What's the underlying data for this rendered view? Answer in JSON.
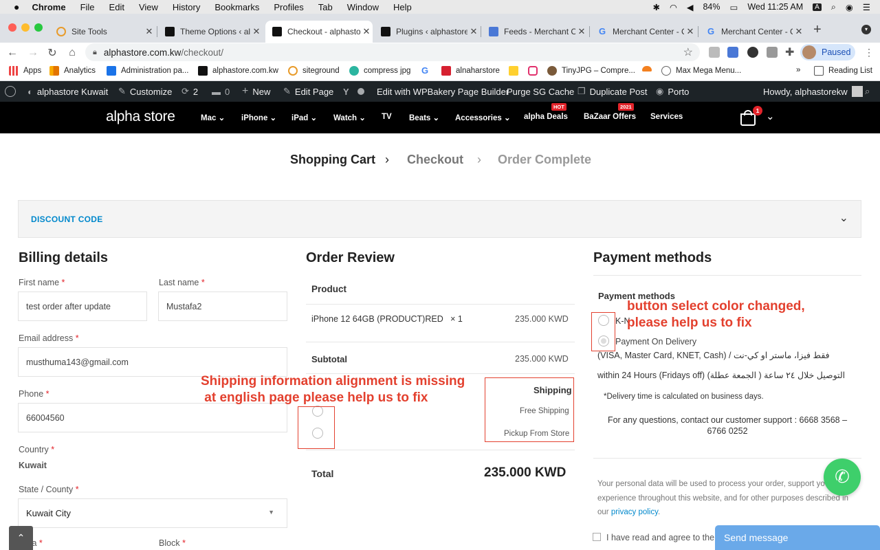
{
  "mac": {
    "apple": "",
    "menu": [
      "Chrome",
      "File",
      "Edit",
      "View",
      "History",
      "Bookmarks",
      "Profiles",
      "Tab",
      "Window",
      "Help"
    ],
    "battery": "84%",
    "clock": "Wed 11:25 AM"
  },
  "tabs": [
    {
      "title": "Site Tools"
    },
    {
      "title": "Theme Options ‹ alp"
    },
    {
      "title": "Checkout - alphasto"
    },
    {
      "title": "Plugins ‹ alphastore"
    },
    {
      "title": "Feeds - Merchant C"
    },
    {
      "title": "Merchant Center - C"
    },
    {
      "title": "Merchant Center - C"
    }
  ],
  "address": {
    "domain": "alphastore.com.kw",
    "path": "/checkout/"
  },
  "profile": {
    "status": "Paused"
  },
  "bookmarks": [
    "Apps",
    "Analytics",
    "Administration pa...",
    "alphastore.com.kw",
    "siteground",
    "compress jpg",
    "alnaharstore",
    "TinyJPG – Compre...",
    "Max Mega Menu..."
  ],
  "reading_list": "Reading List",
  "wp": {
    "site": "alphastore Kuwait",
    "customize": "Customize",
    "updates": "2",
    "comments": "0",
    "new": "New",
    "edit": "Edit Page",
    "wpbakery": "Edit with WPBakery Page Builder",
    "purge": "Purge SG Cache",
    "duplicate": "Duplicate Post",
    "porto": "Porto",
    "howdy": "Howdy, alphastorekw"
  },
  "site": {
    "logo": "alpha store",
    "nav": [
      {
        "label": "Mac",
        "dd": true
      },
      {
        "label": "iPhone",
        "dd": true
      },
      {
        "label": "iPad",
        "dd": true
      },
      {
        "label": "Watch",
        "dd": true
      },
      {
        "label": "TV",
        "dd": false
      },
      {
        "label": "Beats",
        "dd": true
      },
      {
        "label": "Accessories",
        "dd": true
      },
      {
        "label": "alpha Deals",
        "dd": false,
        "badge": "HOT"
      },
      {
        "label": "BaZaar Offers",
        "dd": false,
        "badge": "2021"
      },
      {
        "label": "Services",
        "dd": false
      }
    ],
    "cart_count": "1"
  },
  "steps": [
    "Shopping Cart",
    "Checkout",
    "Order Complete"
  ],
  "discount_label": "DISCOUNT CODE",
  "billing": {
    "title": "Billing details",
    "first_name_label": "First name",
    "first_name": "test order after update",
    "last_name_label": "Last name",
    "last_name": "Mustafa2",
    "email_label": "Email address",
    "email": "musthuma143@gmail.com",
    "phone_label": "Phone",
    "phone": "66004560",
    "country_label": "Country",
    "country": "Kuwait",
    "state_label": "State / County",
    "state": "Kuwait City",
    "area_label": "Area",
    "block_label": "Block",
    "required_mark": "*"
  },
  "order": {
    "title": "Order Review",
    "product_header": "Product",
    "item": "iPhone 12 64GB (PRODUCT)RED",
    "qty": "× 1",
    "item_price": "235.000 KWD",
    "subtotal_label": "Subtotal",
    "subtotal": "235.000 KWD",
    "shipping_label": "Shipping",
    "shipping_options": [
      "Free Shipping",
      "Pickup From Store"
    ],
    "total_label": "Total",
    "total": "235.000 KWD"
  },
  "payment": {
    "title": "Payment methods",
    "sub": "Payment methods",
    "opt1": "K-N",
    "opt2": "Payment On Delivery",
    "line1_en": "(VISA, Master Card, KNET, Cash) /",
    "line1_ar": "فقط فيزا، ماستر او كي-نت",
    "line2_en": "within 24 Hours (Fridays off)",
    "line2_ar": "التوصيل خلال ٢٤ ساعة ( الجمعة عطلة)",
    "delivery_note": "*Delivery time is calculated on business days.",
    "support": "For any questions, contact our customer support : 6668 3568 – 6766 0252",
    "privacy_pre": "Your personal data will be used to process your order, support yo experience throughout this website, and for other purposes described in our",
    "privacy_link": "privacy policy",
    "agree": "I have read and agree to the w"
  },
  "annotations": {
    "button_note": "button select color changed,\nplease help us to fix",
    "shipping_note": "Shipping information alignment is missing\n at english page please help us to fix"
  },
  "chat": {
    "send": "Send message"
  },
  "colors": {
    "accent": "#0088cc",
    "annotation": "#e3402e",
    "hot": "#e3232a",
    "whatsapp": "#3ecf6b"
  }
}
